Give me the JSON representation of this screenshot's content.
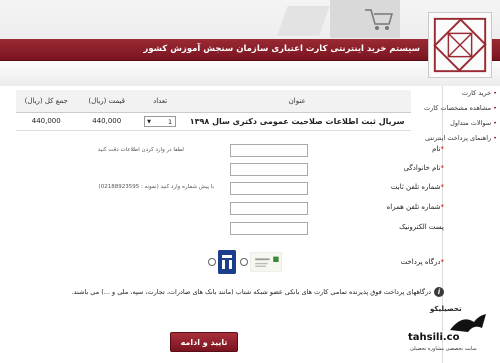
{
  "header": {
    "title": "سیستم خرید اینترنتی کارت اعتباری سازمان سنجش آموزش کشور"
  },
  "sidebar": {
    "items": [
      {
        "label": "خرید کارت"
      },
      {
        "label": "مشاهده مشخصات کارت"
      },
      {
        "label": "سوالات متداول"
      },
      {
        "label": "راهنمای پرداخت اینترنتی"
      }
    ]
  },
  "cart": {
    "headers": {
      "title": "عنوان",
      "qty": "تعداد",
      "price": "قیمت (ریال)",
      "total": "جمع کل (ریال)"
    },
    "row": {
      "title": "سریال ثبت اطلاعات صلاحیت عمومی دکتری سال ۱۳۹۸",
      "qty": "1",
      "price": "440,000",
      "total": "440,000"
    }
  },
  "form": {
    "hint": "لطفا در وارد کردن اطلاعات دقت کنید",
    "first_name": "نام",
    "last_name": "نام خانوادگی",
    "phone": "شماره تلفن ثابت",
    "phone_note": "با پیش شماره وارد کنید (نمونه : 02188923595)",
    "mobile": "شماره تلفن همراه",
    "email": "پست الکترونیک",
    "gateway": "درگاه پرداخت",
    "info": "درگاههای پرداخت فوق پذیرنده تمامی کارت های بانکی عضو شبکه شتاب (مانند بانک های صادرات، تجارت، سپه، ملی و ...) می باشند."
  },
  "submit_label": "تایید و ادامه",
  "watermark": {
    "brand": "tahsili.co",
    "fa": "تحصیلیکو",
    "sub": "سایت تخصصی مشاوره تحصیلی"
  }
}
